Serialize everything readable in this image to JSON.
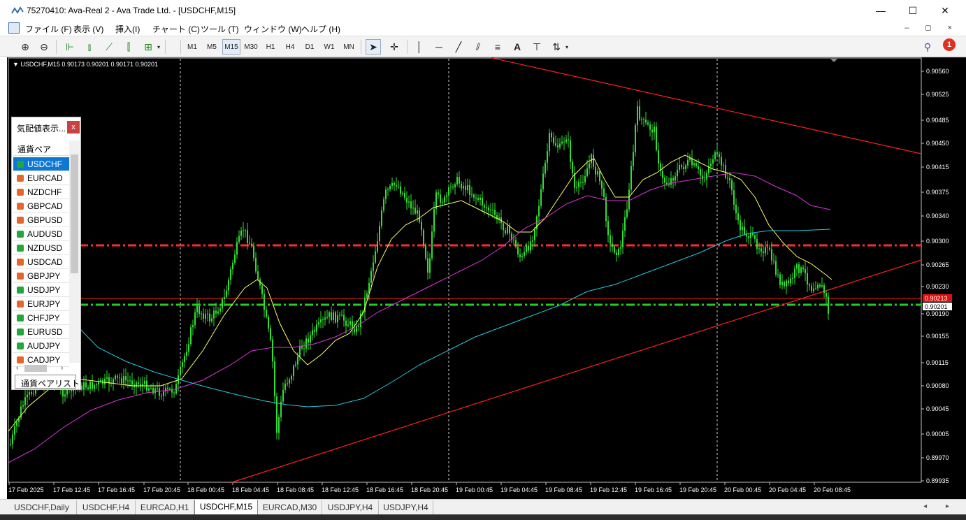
{
  "window": {
    "title": "75270410: Ava-Real 2 - Ava Trade Ltd. - [USDCHF,M15]",
    "min_glyph": "—",
    "max_glyph": "☐",
    "close_glyph": "✕"
  },
  "menu": [
    "ファイル (F)",
    "表示 (V)",
    "挿入(I)",
    "チャート (C)",
    "ツール (T)",
    "ウィンドウ (W)",
    "ヘルプ (H)"
  ],
  "mdi_controls": "– ◻ ×",
  "toolbar": {
    "timeframes": [
      "M1",
      "M5",
      "M15",
      "M30",
      "H1",
      "H4",
      "D1",
      "W1",
      "MN"
    ],
    "active_timeframe": "M15",
    "notification_count": "1"
  },
  "chart": {
    "symbol_info": "USDCHF,M15  0.90173 0.90201 0.90171 0.90201",
    "price_labels": [
      "0.90560",
      "0.90525",
      "0.90485",
      "0.90450",
      "0.90415",
      "0.90375",
      "0.90340",
      "0.90300",
      "0.90265",
      "0.90230",
      "0.90190",
      "0.90155",
      "0.90115",
      "0.90080",
      "0.90045",
      "0.90005",
      "0.89970",
      "0.89935"
    ],
    "current_price_red": "0.90213",
    "current_price_white": "0.90201",
    "time_labels": [
      "17 Feb 2025",
      "17 Feb 12:45",
      "17 Feb 16:45",
      "17 Feb 20:45",
      "18 Feb 00:45",
      "18 Feb 04:45",
      "18 Feb 08:45",
      "18 Feb 12:45",
      "18 Feb 16:45",
      "18 Feb 20:45",
      "19 Feb 00:45",
      "19 Feb 04:45",
      "19 Feb 08:45",
      "19 Feb 12:45",
      "19 Feb 16:45",
      "19 Feb 20:45",
      "20 Feb 00:45",
      "20 Feb 04:45",
      "20 Feb 08:45"
    ],
    "colors": {
      "background": "#000000",
      "candles": "#33dd33",
      "ma_fast": "#ffff66",
      "ma_mid": "#dd33dd",
      "ma_slow": "#22ccdd",
      "trendline": "#ff2020",
      "resistance": "#ff2a2a",
      "support": "#22cc22"
    }
  },
  "market_watch": {
    "title": "気配値表示...",
    "close_label": "x",
    "column_header": "通貨ペア",
    "symbols": [
      {
        "name": "USDCHF",
        "dir": "up"
      },
      {
        "name": "EURCAD",
        "dir": "down"
      },
      {
        "name": "NZDCHF",
        "dir": "down"
      },
      {
        "name": "GBPCAD",
        "dir": "down"
      },
      {
        "name": "GBPUSD",
        "dir": "down"
      },
      {
        "name": "AUDUSD",
        "dir": "up"
      },
      {
        "name": "NZDUSD",
        "dir": "up"
      },
      {
        "name": "USDCAD",
        "dir": "down"
      },
      {
        "name": "GBPJPY",
        "dir": "down"
      },
      {
        "name": "USDJPY",
        "dir": "up"
      },
      {
        "name": "EURJPY",
        "dir": "down"
      },
      {
        "name": "CHFJPY",
        "dir": "up"
      },
      {
        "name": "EURUSD",
        "dir": "up"
      },
      {
        "name": "AUDJPY",
        "dir": "up"
      },
      {
        "name": "CADJPY",
        "dir": "down"
      }
    ],
    "tab_label": "通貨ペアリスト"
  },
  "chart_tabs": [
    "USDCHF,Daily",
    "USDCHF,H4",
    "EURCAD,H1",
    "USDCHF,M15",
    "EURCAD,M30",
    "USDJPY,H4",
    "USDJPY,H4"
  ],
  "active_chart_tab": "USDCHF,M15",
  "tab_nav": "◂ ▸"
}
